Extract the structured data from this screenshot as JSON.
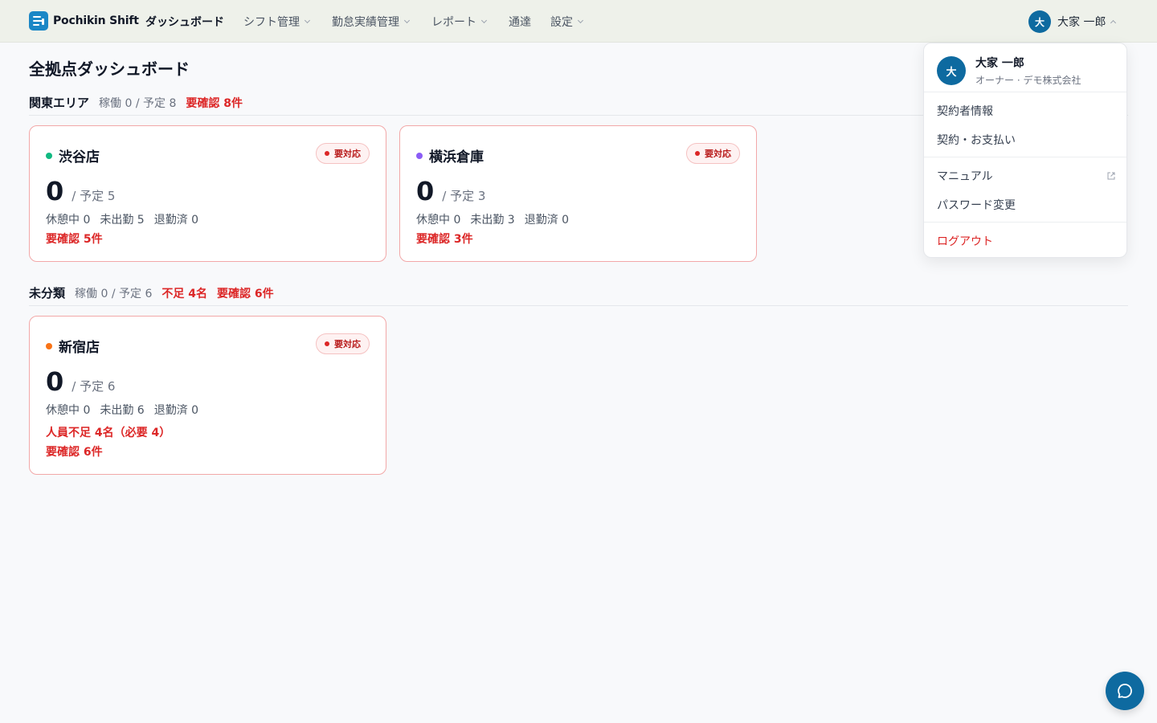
{
  "app": {
    "name": "Pochikin Shift",
    "nav": [
      {
        "label": "ダッシュボード",
        "active": true
      },
      {
        "label": "シフト管理"
      },
      {
        "label": "勤怠実績管理"
      },
      {
        "label": "レポート"
      },
      {
        "label": "通達"
      },
      {
        "label": "設定"
      }
    ],
    "user": {
      "initial": "大",
      "name": "大家 一郎"
    }
  },
  "page": {
    "title": "全拠点ダッシュボード"
  },
  "sections": [
    {
      "name": "関東エリア",
      "meta": "稼働 0 / 予定 8",
      "alerts": [
        "要確認 8件"
      ],
      "cards": [
        {
          "name": "渋谷店",
          "dot_color": "#10b981",
          "badge": "要対応",
          "working": "0",
          "planned": "/ 予定 5",
          "stats": [
            "休憩中 0",
            "未出勤 5",
            "退勤済 0"
          ],
          "alerts": [
            "要確認 5件"
          ]
        },
        {
          "name": "横浜倉庫",
          "dot_color": "#8b5cf6",
          "badge": "要対応",
          "working": "0",
          "planned": "/ 予定 3",
          "stats": [
            "休憩中 0",
            "未出勤 3",
            "退勤済 0"
          ],
          "alerts": [
            "要確認 3件"
          ]
        }
      ]
    },
    {
      "name": "未分類",
      "meta": "稼働 0 / 予定 6",
      "alerts": [
        "不足 4名",
        "要確認 6件"
      ],
      "cards": [
        {
          "name": "新宿店",
          "dot_color": "#f97316",
          "badge": "要対応",
          "working": "0",
          "planned": "/ 予定 6",
          "stats": [
            "休憩中 0",
            "未出勤 6",
            "退勤済 0"
          ],
          "alerts": [
            "人員不足 4名（必要 4）",
            "要確認 6件"
          ]
        }
      ]
    }
  ],
  "dropdown": {
    "name": "大家 一郎",
    "role": "オーナー · デモ株式会社",
    "items": [
      "契約者情報",
      "契約・お支払い",
      "マニュアル",
      "パスワード変更",
      "ログアウト"
    ]
  },
  "colors": {
    "brand": "#0e6aa0",
    "alert": "#dc2626",
    "header_bg": "#eef1ea"
  },
  "icons": {
    "chat": "chat-bubble-icon",
    "external": "external-link-icon"
  }
}
